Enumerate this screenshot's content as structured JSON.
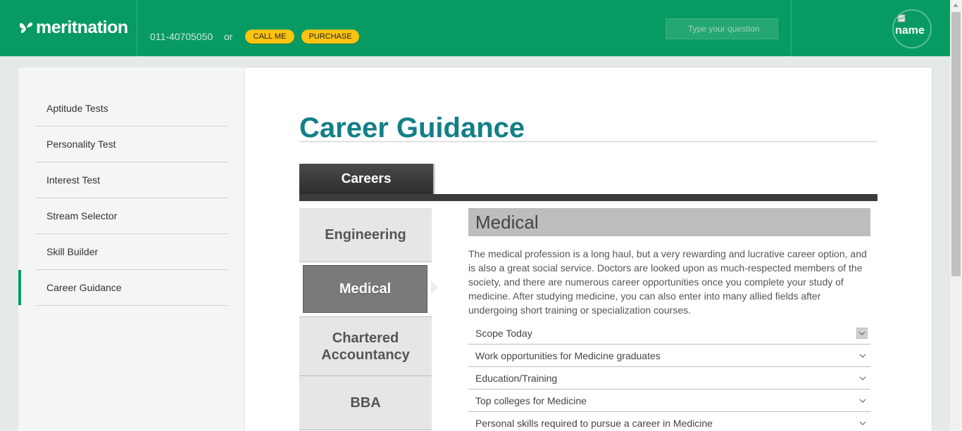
{
  "header": {
    "logo_text": "meritnation",
    "phone": "011-40705050",
    "or_label": "or",
    "call_me_label": "CALL ME",
    "purchase_label": "PURCHASE",
    "search_placeholder": "Type your question",
    "avatar_alt": "name"
  },
  "sidebar": {
    "items": [
      {
        "label": "Aptitude Tests"
      },
      {
        "label": "Personality Test"
      },
      {
        "label": "Interest Test"
      },
      {
        "label": "Stream Selector"
      },
      {
        "label": "Skill Builder"
      },
      {
        "label": "Career Guidance",
        "active": true
      }
    ]
  },
  "main": {
    "title": "Career Guidance",
    "tab_label": "Careers",
    "careers": [
      {
        "label": "Engineering"
      },
      {
        "label": "Medical",
        "selected": true
      },
      {
        "label": "Chartered Accountancy"
      },
      {
        "label": "BBA"
      }
    ],
    "detail": {
      "heading": "Medical",
      "description": "The medical profession is a long haul, but a very rewarding and lucrative career option, and is also a great social service. Doctors are looked upon as much-respected members of the society, and there are numerous career opportunities once you complete your study of medicine. After studying medicine, you can also enter into many allied fields after undergoing short training or specialization courses.",
      "accordion": [
        {
          "label": "Scope Today"
        },
        {
          "label": "Work opportunities for Medicine graduates"
        },
        {
          "label": "Education/Training"
        },
        {
          "label": "Top colleges for Medicine"
        },
        {
          "label": "Personal skills required to pursue a career in Medicine"
        }
      ]
    }
  },
  "colors": {
    "brand_green": "#079b63",
    "title_teal": "#137f87",
    "button_yellow": "#fdc310"
  }
}
